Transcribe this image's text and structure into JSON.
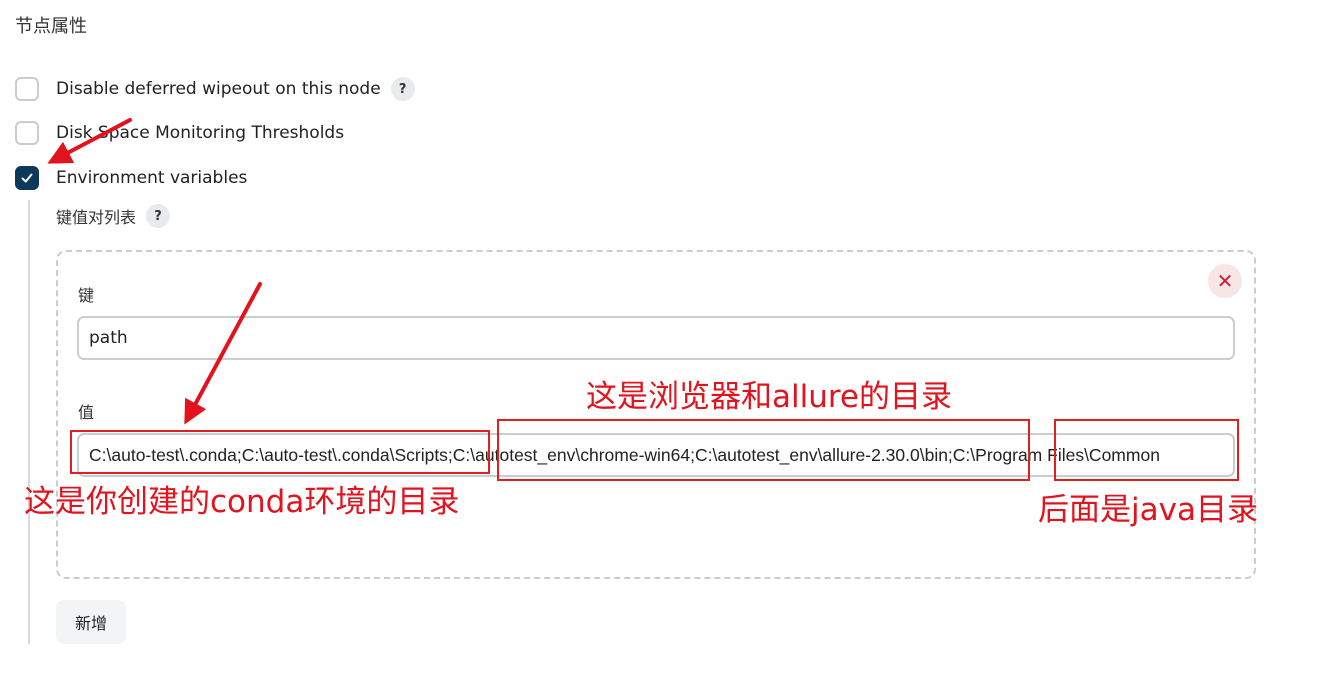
{
  "section": {
    "title": "节点属性"
  },
  "checkboxes": [
    {
      "label": "Disable deferred wipeout on this node",
      "checked": false,
      "has_help": true
    },
    {
      "label": "Disk Space Monitoring Thresholds",
      "checked": false,
      "has_help": false
    },
    {
      "label": "Environment variables",
      "checked": true,
      "has_help": false
    }
  ],
  "help_glyph": "?",
  "env": {
    "list_label": "键值对列表",
    "key_label": "键",
    "key_value": "path",
    "value_label": "值",
    "value_value": "C:\\auto-test\\.conda;C:\\auto-test\\.conda\\Scripts;C:\\autotest_env\\chrome-win64;C:\\autotest_env\\allure-2.30.0\\bin;C:\\Program Files\\Common",
    "delete_glyph": "✕",
    "add_label": "新增"
  },
  "annotations": {
    "browser_allure": "这是浏览器和allure的目录",
    "conda_env": "这是你创建的conda环境的目录",
    "java": "后面是java目录"
  },
  "colors": {
    "accent_checked": "#0c3859",
    "annotation_red": "#e02020",
    "delete_red": "#cc2230"
  }
}
